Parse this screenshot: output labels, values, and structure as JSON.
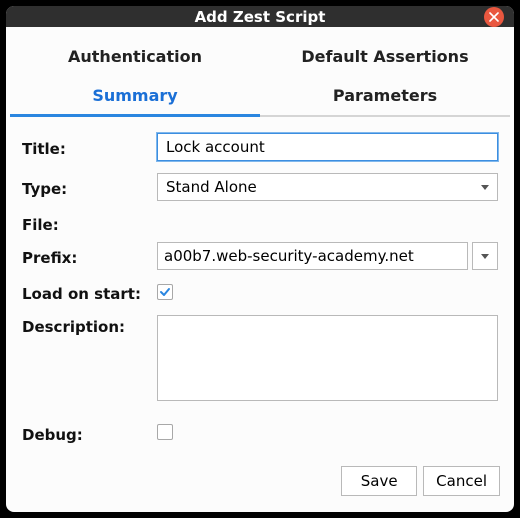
{
  "window": {
    "title": "Add Zest Script"
  },
  "tabs": {
    "row1": [
      "Authentication",
      "Default Assertions"
    ],
    "row2": [
      "Summary",
      "Parameters"
    ],
    "active_row": 1,
    "active_col": 0
  },
  "form": {
    "title": {
      "label": "Title:",
      "value": "Lock account"
    },
    "type": {
      "label": "Type:",
      "value": "Stand Alone"
    },
    "file": {
      "label": "File:"
    },
    "prefix": {
      "label": "Prefix:",
      "value": "a00b7.web-security-academy.net"
    },
    "load_on_start": {
      "label": "Load on start:",
      "checked": true
    },
    "description": {
      "label": "Description:",
      "value": ""
    },
    "debug": {
      "label": "Debug:",
      "checked": false
    }
  },
  "buttons": {
    "save": "Save",
    "cancel": "Cancel"
  }
}
